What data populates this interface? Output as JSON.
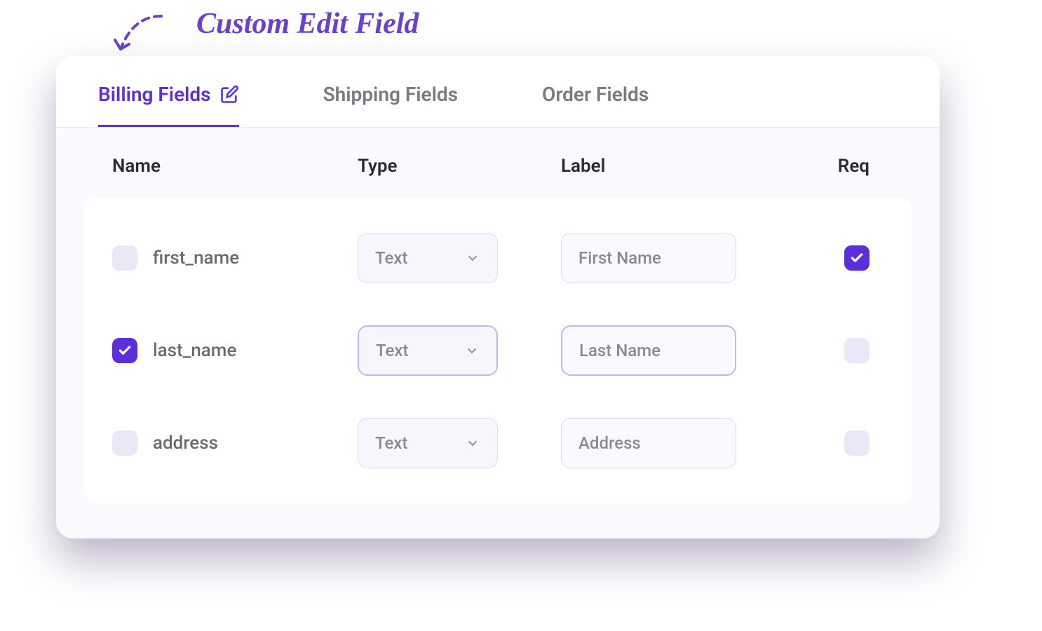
{
  "annotation": {
    "text": "Custom Edit Field"
  },
  "tabs": [
    {
      "label": "Billing Fields",
      "active": true,
      "has_edit_icon": true
    },
    {
      "label": "Shipping Fields",
      "active": false,
      "has_edit_icon": false
    },
    {
      "label": "Order Fields",
      "active": false,
      "has_edit_icon": false
    }
  ],
  "columns": {
    "name": "Name",
    "type": "Type",
    "label": "Label",
    "req": "Req"
  },
  "rows": [
    {
      "checked": false,
      "name": "first_name",
      "type": "Text",
      "label": "First Name",
      "required": true,
      "highlighted": false
    },
    {
      "checked": true,
      "name": "last_name",
      "type": "Text",
      "label": "Last Name",
      "required": false,
      "highlighted": true
    },
    {
      "checked": false,
      "name": "address",
      "type": "Text",
      "label": "Address",
      "required": false,
      "highlighted": false
    }
  ],
  "colors": {
    "accent": "#5b2fd9",
    "checkbox_unchecked": "#ece7f7",
    "text_muted": "#7a7a85"
  }
}
